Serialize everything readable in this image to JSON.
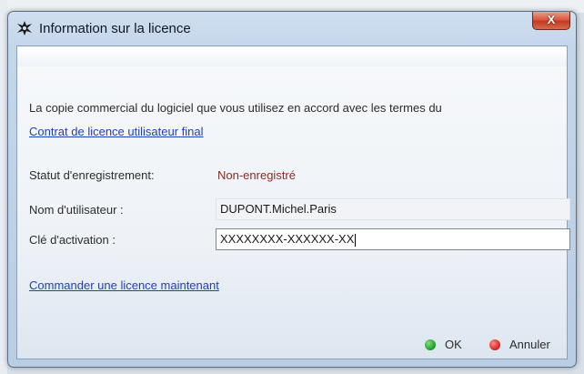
{
  "window": {
    "title": "Information sur la licence",
    "close_label": "X"
  },
  "content": {
    "intro_text": "La copie commercial du logiciel que vous utilisez en accord avec les termes du",
    "eula_link": "Contrat de licence utilisateur final",
    "status_label": "Statut d'enregistrement:",
    "status_value": "Non-enregistré",
    "username_label": "Nom d'utilisateur :",
    "username_value": "DUPONT.Michel.Paris",
    "activation_label": "Clé d'activation :",
    "activation_value": "XXXXXXXX-XXXXXX-XX",
    "order_link": "Commander une licence maintenant"
  },
  "buttons": {
    "ok_label": "OK",
    "cancel_label": "Annuler"
  },
  "colors": {
    "link": "#1f3fbf",
    "status_value": "#8b2b22",
    "ok_dot": "#1a9a22",
    "cancel_dot": "#d41f1f"
  }
}
